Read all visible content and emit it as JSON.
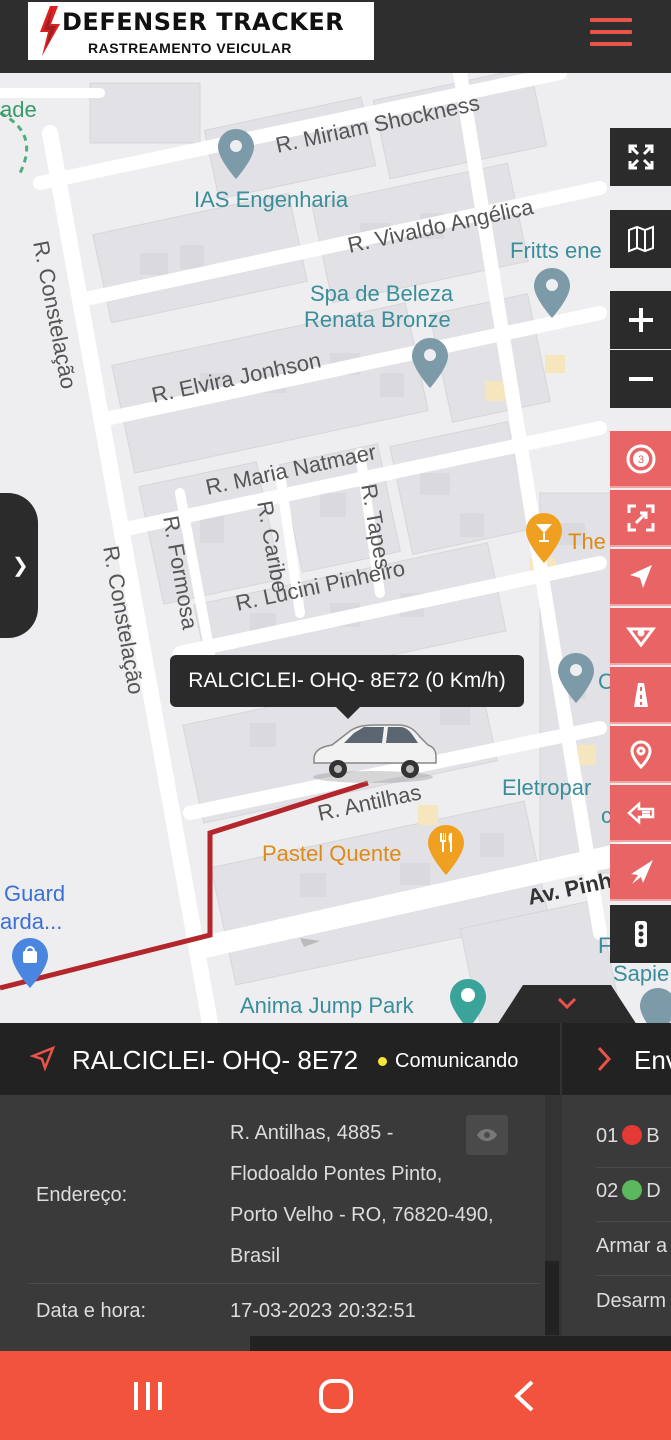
{
  "header": {
    "brand": "DEFENSER TRACKER",
    "tagline": "RASTREAMENTO VEICULAR",
    "menu_icon": "hamburger-icon"
  },
  "colors": {
    "accent_red": "#e96565",
    "nav_red": "#f2533d",
    "route": "#b3262c",
    "status_dot": "#f7e63c"
  },
  "map": {
    "streets": [
      "R. Miriam Shockness",
      "R. Vivaldo Angélica",
      "R. Constelação",
      "R. Elvira Jonhson",
      "R. Maria Natmaer",
      "R. Formosa",
      "R. Caribe",
      "R. Tapes",
      "R. Constelação",
      "R. Lucini Pinheiro",
      "R. Antilhas",
      "Av. Pinh"
    ],
    "pois": {
      "ade": "ade",
      "ias": "IAS Engenharia",
      "fritts": "Fritts ene",
      "spa_1": "Spa de Beleza",
      "spa_2": "Renata Bronze",
      "the": "The",
      "c_partial": "C",
      "eletropar": "Eletropar",
      "eletropar_2": "c",
      "pastel": "Pastel Quente",
      "guard_1": "Guard",
      "guard_2": "arda...",
      "anima": "Anima Jump Park",
      "f_partial": "F",
      "sapie": "Sapie"
    },
    "tooltip": "RALCICLEI- OHQ- 8E72 (0 Km/h)",
    "controls": [
      "fullscreen-icon",
      "map-layers-icon",
      "zoom-in-icon",
      "zoom-out-icon"
    ],
    "tools": [
      "speed-limit-icon",
      "focus-icon",
      "navigate-icon",
      "route-icon",
      "road-icon",
      "location-pin-icon",
      "history-icon",
      "send-command-icon",
      "traffic-light-icon"
    ],
    "speed_badge": "3"
  },
  "panel": {
    "vehicle": "RALCICLEI- OHQ- 8E72",
    "status": "Comunicando",
    "env_label": "Env",
    "address_label": "Endereço:",
    "address_lines": [
      "R. Antilhas, 4885 -",
      "Flodoaldo Pontes Pinto,",
      "Porto Velho - RO, 76820-490,",
      "Brasil"
    ],
    "datetime_label": "Data e hora:",
    "datetime": "17-03-2023 20:32:51",
    "commands": [
      {
        "num": "01",
        "color": "#e53935",
        "label": "B"
      },
      {
        "num": "02",
        "color": "#5cb85c",
        "label": "D"
      },
      {
        "label": "Armar a"
      },
      {
        "label": "Desarm"
      }
    ]
  },
  "navbar": {
    "recents": "recents-icon",
    "home": "home-icon",
    "back": "back-icon"
  }
}
